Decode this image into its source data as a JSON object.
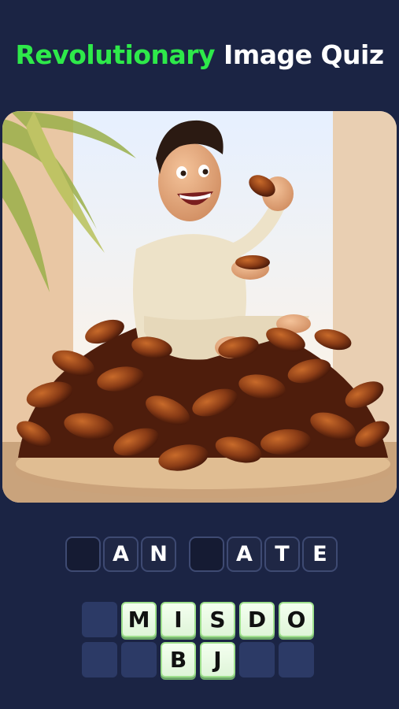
{
  "title": {
    "accent": "Revolutionary",
    "rest": "Image Quiz"
  },
  "colors": {
    "accent": "#2ee94a",
    "background": "#1b2444"
  },
  "image": {
    "icon": "man-eating-dates-illustration"
  },
  "answer": {
    "slots": [
      "",
      "A",
      "N",
      "",
      "A",
      "T",
      "E"
    ]
  },
  "keyboard": {
    "rows": [
      [
        "",
        "M",
        "I",
        "S",
        "D",
        "O"
      ],
      [
        "",
        "",
        "B",
        "J",
        "",
        ""
      ]
    ]
  }
}
